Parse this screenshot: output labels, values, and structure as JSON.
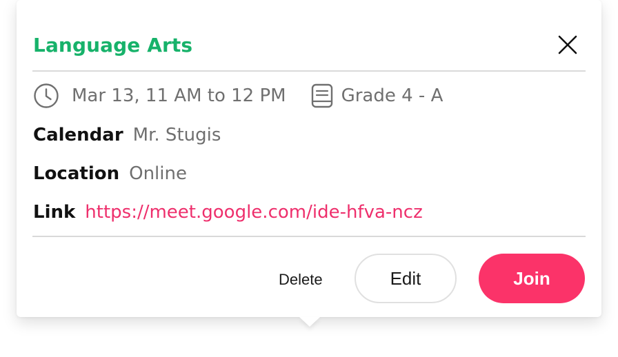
{
  "event": {
    "title": "Language Arts",
    "time": "Mar 13, 11 AM to 12 PM",
    "class_name": "Grade 4 - A",
    "calendar_label": "Calendar",
    "calendar_value": "Mr. Stugis",
    "location_label": "Location",
    "location_value": "Online",
    "link_label": "Link",
    "link_value": "https://meet.google.com/ide-hfva-ncz"
  },
  "actions": {
    "delete_label": "Delete",
    "edit_label": "Edit",
    "join_label": "Join"
  },
  "icons": {
    "close": "close-icon",
    "time": "clock-icon",
    "class": "book-icon"
  },
  "colors": {
    "title": "#17b26a",
    "link": "#ee2f6c",
    "join_button": "#fb3369",
    "muted_text": "#6f6f6f",
    "divider": "#d9d9d9"
  }
}
